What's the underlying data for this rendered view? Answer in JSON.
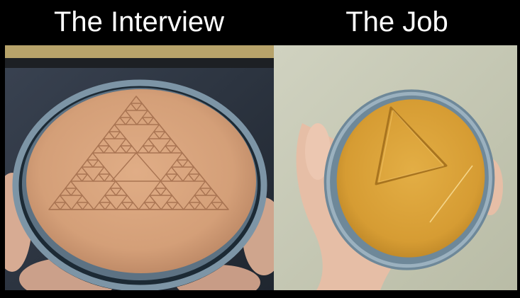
{
  "meme": {
    "left_caption": "The Interview",
    "right_caption": "The Job"
  },
  "illustration": {
    "left_icon": "sierpinski-triangle-dalgona-icon",
    "right_icon": "simple-triangle-dalgona-icon",
    "colors": {
      "background": "#000000",
      "caption": "#ffffff",
      "tin": "#7c93a4",
      "honeycomb_left": "#d6a37c",
      "honeycomb_right": "#d9a13a",
      "skin": "#e8bfa6"
    }
  }
}
